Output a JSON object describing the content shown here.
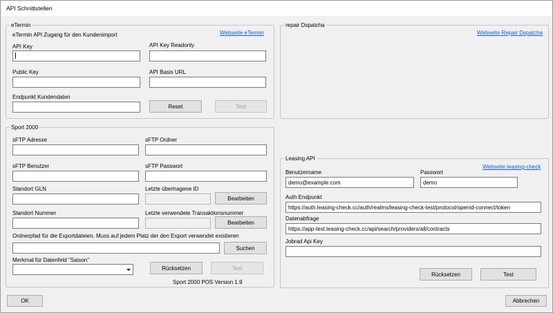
{
  "window": {
    "title": "API Schnittstellen"
  },
  "etermin": {
    "title": "eTermin",
    "subtitle": "eTermin API Zugang für den Kundenimport",
    "website_link": "Webseite eTermin",
    "api_key_label": "API Key",
    "api_key_value": "",
    "api_key_readonly_label": "API Key Readonly",
    "api_key_readonly_value": "",
    "public_key_label": "Public Key",
    "public_key_value": "",
    "api_base_url_label": "API Basis URL",
    "api_base_url_value": "",
    "endpoint_label": "Endpunkt Kundendaten",
    "endpoint_value": "",
    "reset_button": "Reset",
    "test_button": "Test"
  },
  "repair": {
    "title": "repair Dspatcha",
    "website_link": "Webseite Repair Dspatcha"
  },
  "sport2000": {
    "title": "Sport 2000",
    "sftp_address_label": "sFTP Adresse",
    "sftp_address_value": "",
    "sftp_folder_label": "sFTP Ordner",
    "sftp_folder_value": "",
    "sftp_user_label": "sFTP Benutzer",
    "sftp_user_value": "",
    "sftp_password_label": "sFTP Passwort",
    "sftp_password_value": "",
    "location_gln_label": "Standort GLN",
    "location_gln_value": "",
    "last_id_label": "Letzte übertragene ID",
    "last_id_value": "",
    "edit_button_1": "Bearbeiten",
    "location_number_label": "Standort Nummer",
    "location_number_value": "",
    "last_txn_label": "Letzte verwendete Transaktionsnummer",
    "last_txn_value": "",
    "edit_button_2": "Bearbeiten",
    "export_path_label": "Ordnerpfad für die Exportdateien. Muss auf jedem Platz der den Export verwendet existieren",
    "export_path_value": "",
    "search_button": "Suchen",
    "season_label": "Merkmal für Datenfeld \"Saison\"",
    "season_value": "",
    "reset_button": "Rücksetzen",
    "test_button": "Test",
    "version_text": "Sport 2000 POS Version 1.9"
  },
  "leasing": {
    "title": "Leasing API",
    "website_link": "Webseite leasing-check",
    "username_label": "Benutzername",
    "username_value": "demo@example.com",
    "password_label": "Passwort",
    "password_value": "demo",
    "auth_endpoint_label": "Auth Endpunkt",
    "auth_endpoint_value": "https://auth.leasing-check.cc/auth/realms/leasing-check-test/protocol/openid-connect/token",
    "data_query_label": "Datenabfrage",
    "data_query_value": "https://app-test.leasing-check.cc/api/search/providers/all/contracts",
    "jobrad_label": "Jobrad Api Key",
    "jobrad_value": "",
    "reset_button": "Rücksetzen",
    "test_button": "Test"
  },
  "footer": {
    "ok_button": "OK",
    "cancel_button": "Abbrechen"
  }
}
